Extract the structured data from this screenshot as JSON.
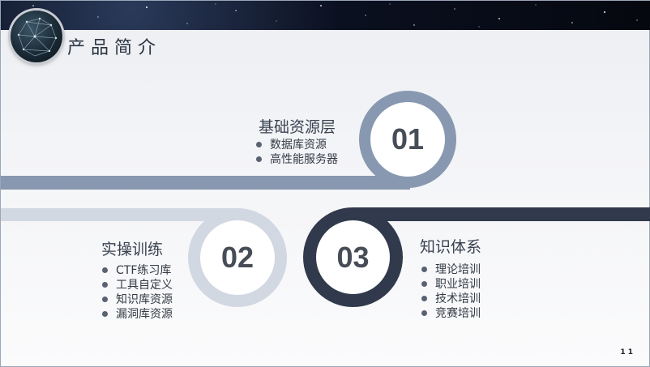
{
  "slide": {
    "title": "产品简介",
    "page_number": "1 1",
    "colors": {
      "steel": "#8898b0",
      "light": "#d2d8e2",
      "dark": "#313a4c"
    }
  },
  "sections": [
    {
      "number": "01",
      "heading": "基础资源层",
      "items": [
        "数据库资源",
        "高性能服务器"
      ]
    },
    {
      "number": "02",
      "heading": "实操训练",
      "items": [
        "CTF练习库",
        "工具自定义",
        "知识库资源",
        "漏洞库资源"
      ]
    },
    {
      "number": "03",
      "heading": "知识体系",
      "items": [
        "理论培训",
        "职业培训",
        "技术培训",
        "竞赛培训"
      ]
    }
  ]
}
